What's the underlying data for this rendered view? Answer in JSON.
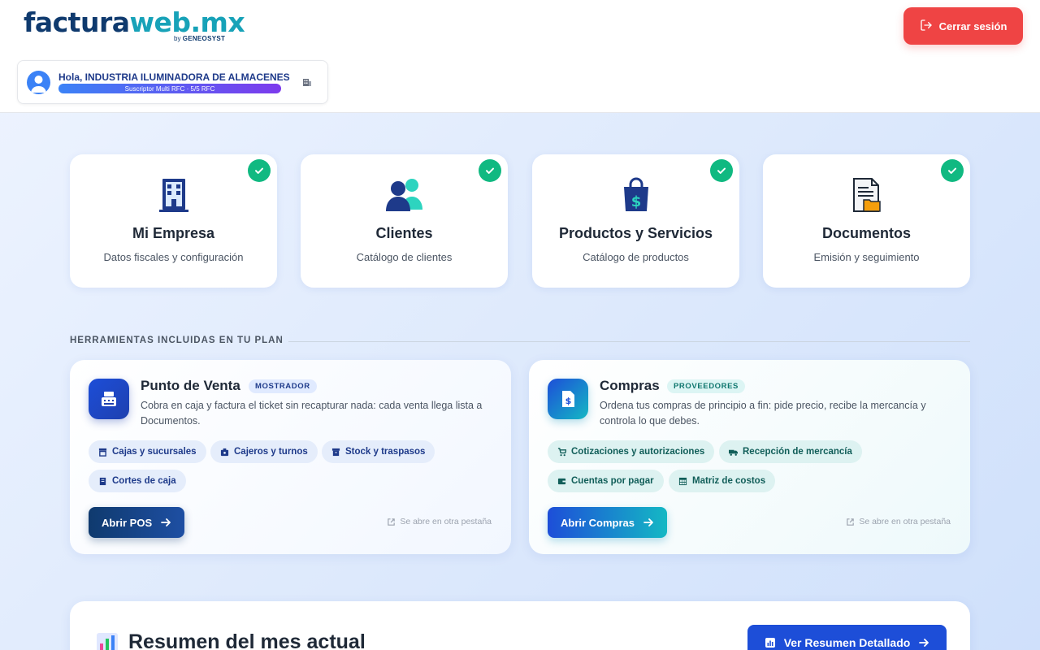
{
  "header": {
    "logo_part1": "factura",
    "logo_part2": "web.mx",
    "logo_by": "by",
    "logo_by_brand": "GENEOSYST",
    "logout_label": "Cerrar sesión",
    "greeting": "Hola, INDUSTRIA ILUMINADORA DE ALMACENES",
    "plan_label": "Suscriptor Multi RFC · 5/5 RFC"
  },
  "modules": [
    {
      "title": "Mi Empresa",
      "subtitle": "Datos fiscales y configuración",
      "icon": "building-icon"
    },
    {
      "title": "Clientes",
      "subtitle": "Catálogo de clientes",
      "icon": "users-icon"
    },
    {
      "title": "Productos y Servicios",
      "subtitle": "Catálogo de productos",
      "icon": "shopping-bag-icon"
    },
    {
      "title": "Documentos",
      "subtitle": "Emisión y seguimiento",
      "icon": "document-folder-icon"
    }
  ],
  "tools_section": {
    "label": "HERRAMIENTAS INCLUIDAS EN TU PLAN"
  },
  "pos": {
    "title": "Punto de Venta",
    "tag": "MOSTRADOR",
    "description": "Cobra en caja y factura el ticket sin recapturar nada: cada venta llega lista a Documentos.",
    "chips": [
      "Cajas y sucursales",
      "Cajeros y turnos",
      "Stock y traspasos",
      "Cortes de caja"
    ],
    "button": "Abrir POS",
    "note": "Se abre en otra pestaña"
  },
  "compras": {
    "title": "Compras",
    "tag": "PROVEEDORES",
    "description": "Ordena tus compras de principio a fin: pide precio, recibe la mercancía y controla lo que debes.",
    "chips": [
      "Cotizaciones y autorizaciones",
      "Recepción de mercancía",
      "Cuentas por pagar",
      "Matriz de costos"
    ],
    "button": "Abrir Compras",
    "note": "Se abre en otra pestaña"
  },
  "summary": {
    "title": "Resumen del mes actual",
    "button": "Ver Resumen Detallado"
  },
  "colors": {
    "accent": "#1d4ed8",
    "brand_dark": "#0f3a6e",
    "brand_teal": "#17a2b8",
    "danger": "#ef4444",
    "success": "#10b981"
  }
}
